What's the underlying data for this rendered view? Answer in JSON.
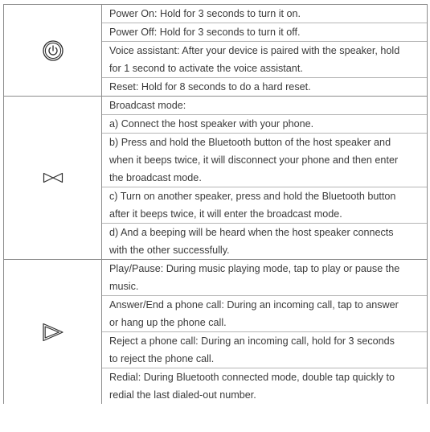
{
  "groups": [
    {
      "icon": "power-icon",
      "rows": [
        [
          "Power On: Hold for 3 seconds to turn it on."
        ],
        [
          "Power Off: Hold for 3 seconds to turn it off."
        ],
        [
          "Voice assistant: After your device is paired with the speaker, hold",
          "for 1 second to activate the voice assistant."
        ],
        [
          "Reset: Hold for 8 seconds to do a hard reset."
        ]
      ]
    },
    {
      "icon": "broadcast-icon",
      "rows": [
        [
          "Broadcast mode:"
        ],
        [
          "a) Connect the host speaker with your phone."
        ],
        [
          "b) Press and hold the Bluetooth button of the host speaker and",
          "when it beeps twice, it will disconnect your phone and then enter",
          "the broadcast mode."
        ],
        [
          "c) Turn on another speaker, press and hold the Bluetooth button",
          "after it beeps twice, it will enter the broadcast mode."
        ],
        [
          "d) And a beeping will be heard when the host speaker connects",
          "with the other successfully."
        ]
      ]
    },
    {
      "icon": "play-icon",
      "rows": [
        [
          "Play/Pause: During music playing mode, tap to play or pause the",
          "music."
        ],
        [
          "Answer/End a phone call: During an incoming call, tap to answer",
          "or hang up the phone call."
        ],
        [
          "Reject a phone call: During an incoming call, hold for 3 seconds",
          "to reject the phone call."
        ],
        [
          "Redial: During Bluetooth connected mode, double tap quickly to",
          "redial the last dialed-out number."
        ]
      ]
    }
  ]
}
